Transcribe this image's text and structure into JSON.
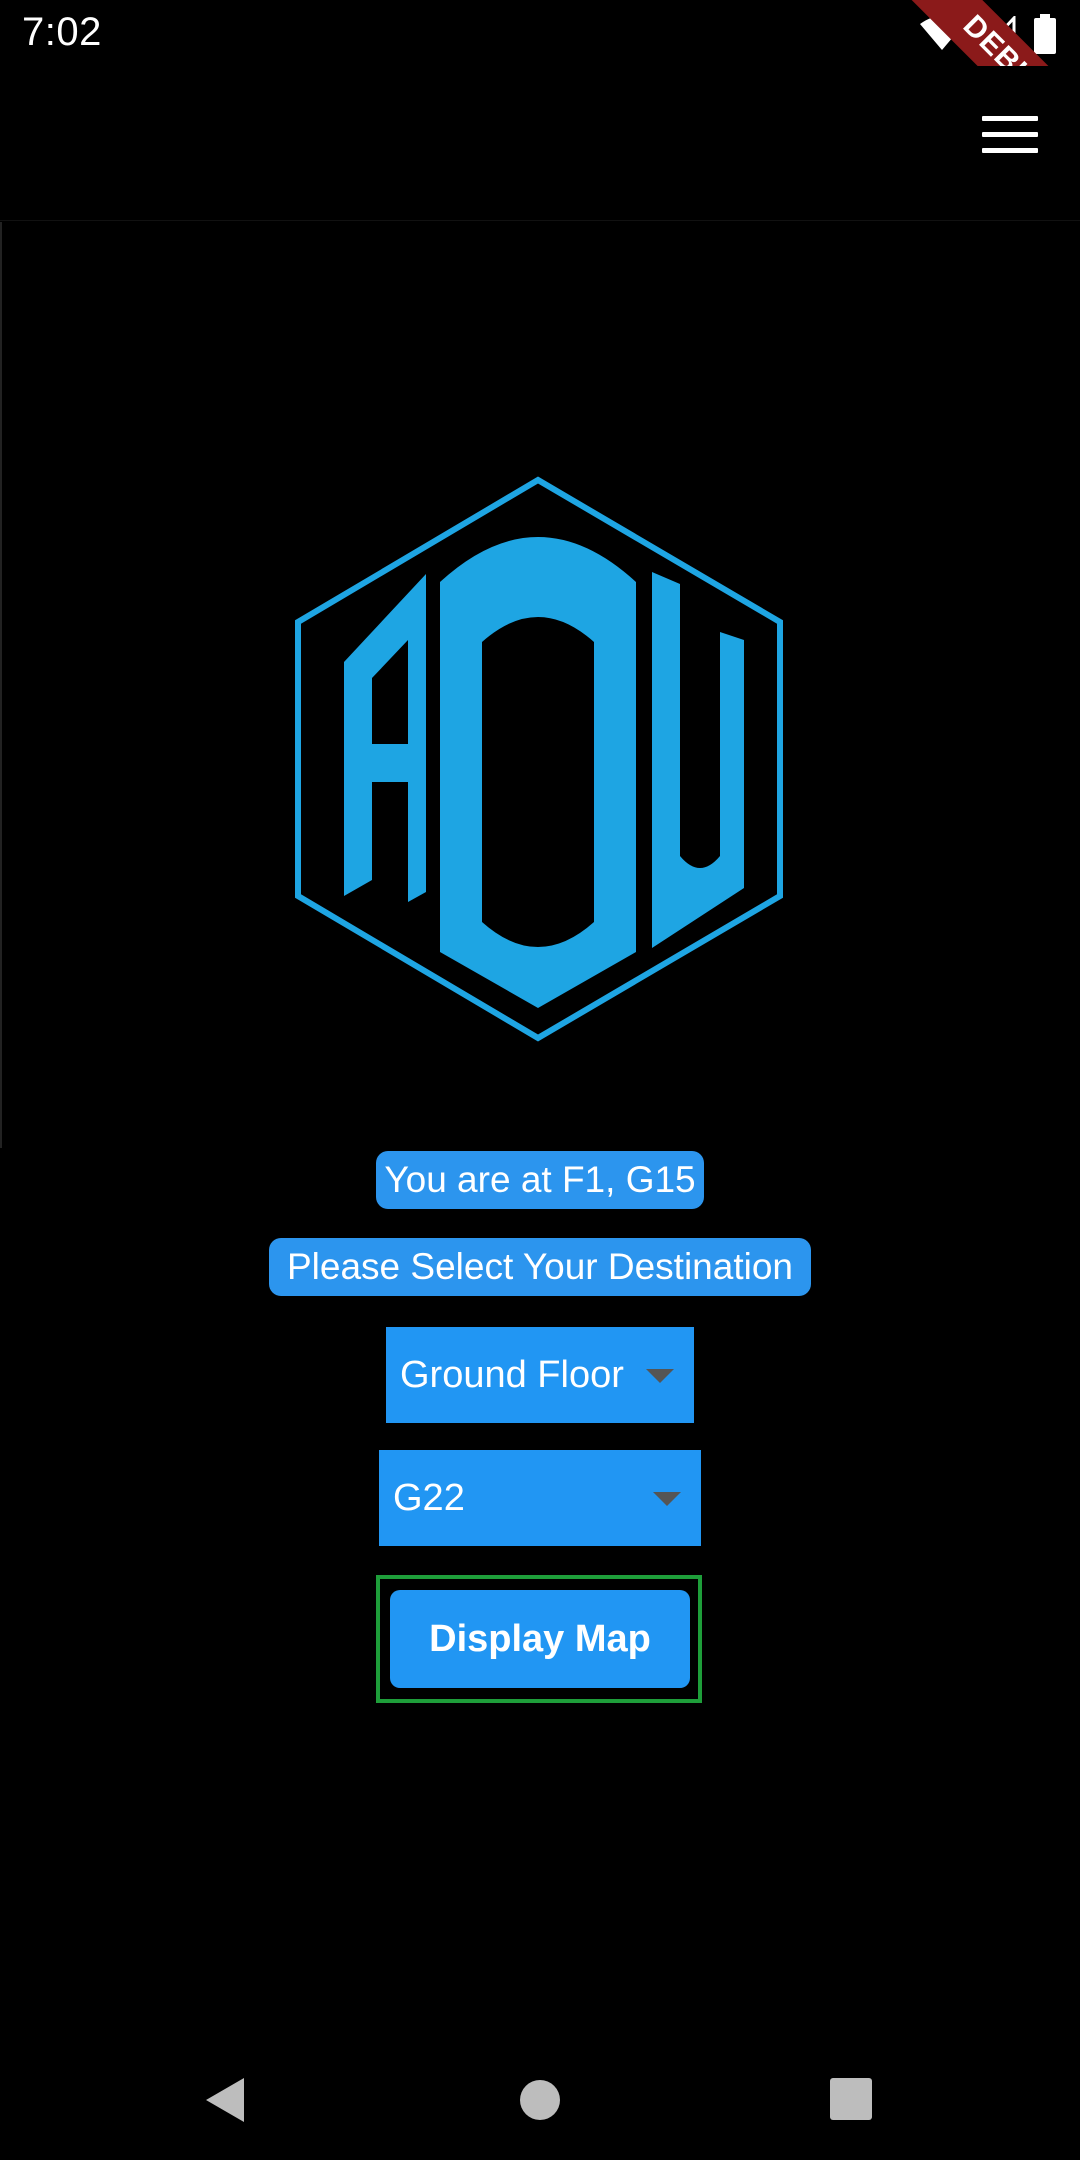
{
  "status_bar": {
    "time": "7:02",
    "icons": [
      "wifi-icon",
      "cell-signal-icon",
      "battery-icon"
    ]
  },
  "debug_banner": {
    "label": "DEBUG"
  },
  "app_bar": {
    "menu_icon": "hamburger-menu-icon"
  },
  "logo": {
    "text": "ADU",
    "color": "#1ea5e3"
  },
  "main": {
    "location_text": "You are at F1, G15",
    "select_prompt": "Please Select Your Destination",
    "floor_dropdown": {
      "selected": "Ground Floor"
    },
    "room_dropdown": {
      "selected": "G22"
    },
    "display_map_label": "Display Map"
  },
  "nav_bar": {
    "icons": [
      "back-icon",
      "home-icon",
      "recents-icon"
    ]
  },
  "colors": {
    "background": "#000000",
    "accent": "#2196f3",
    "pill": "#2c95ee",
    "focus": "#1e9e3a",
    "debug": "#8b1a1a"
  }
}
